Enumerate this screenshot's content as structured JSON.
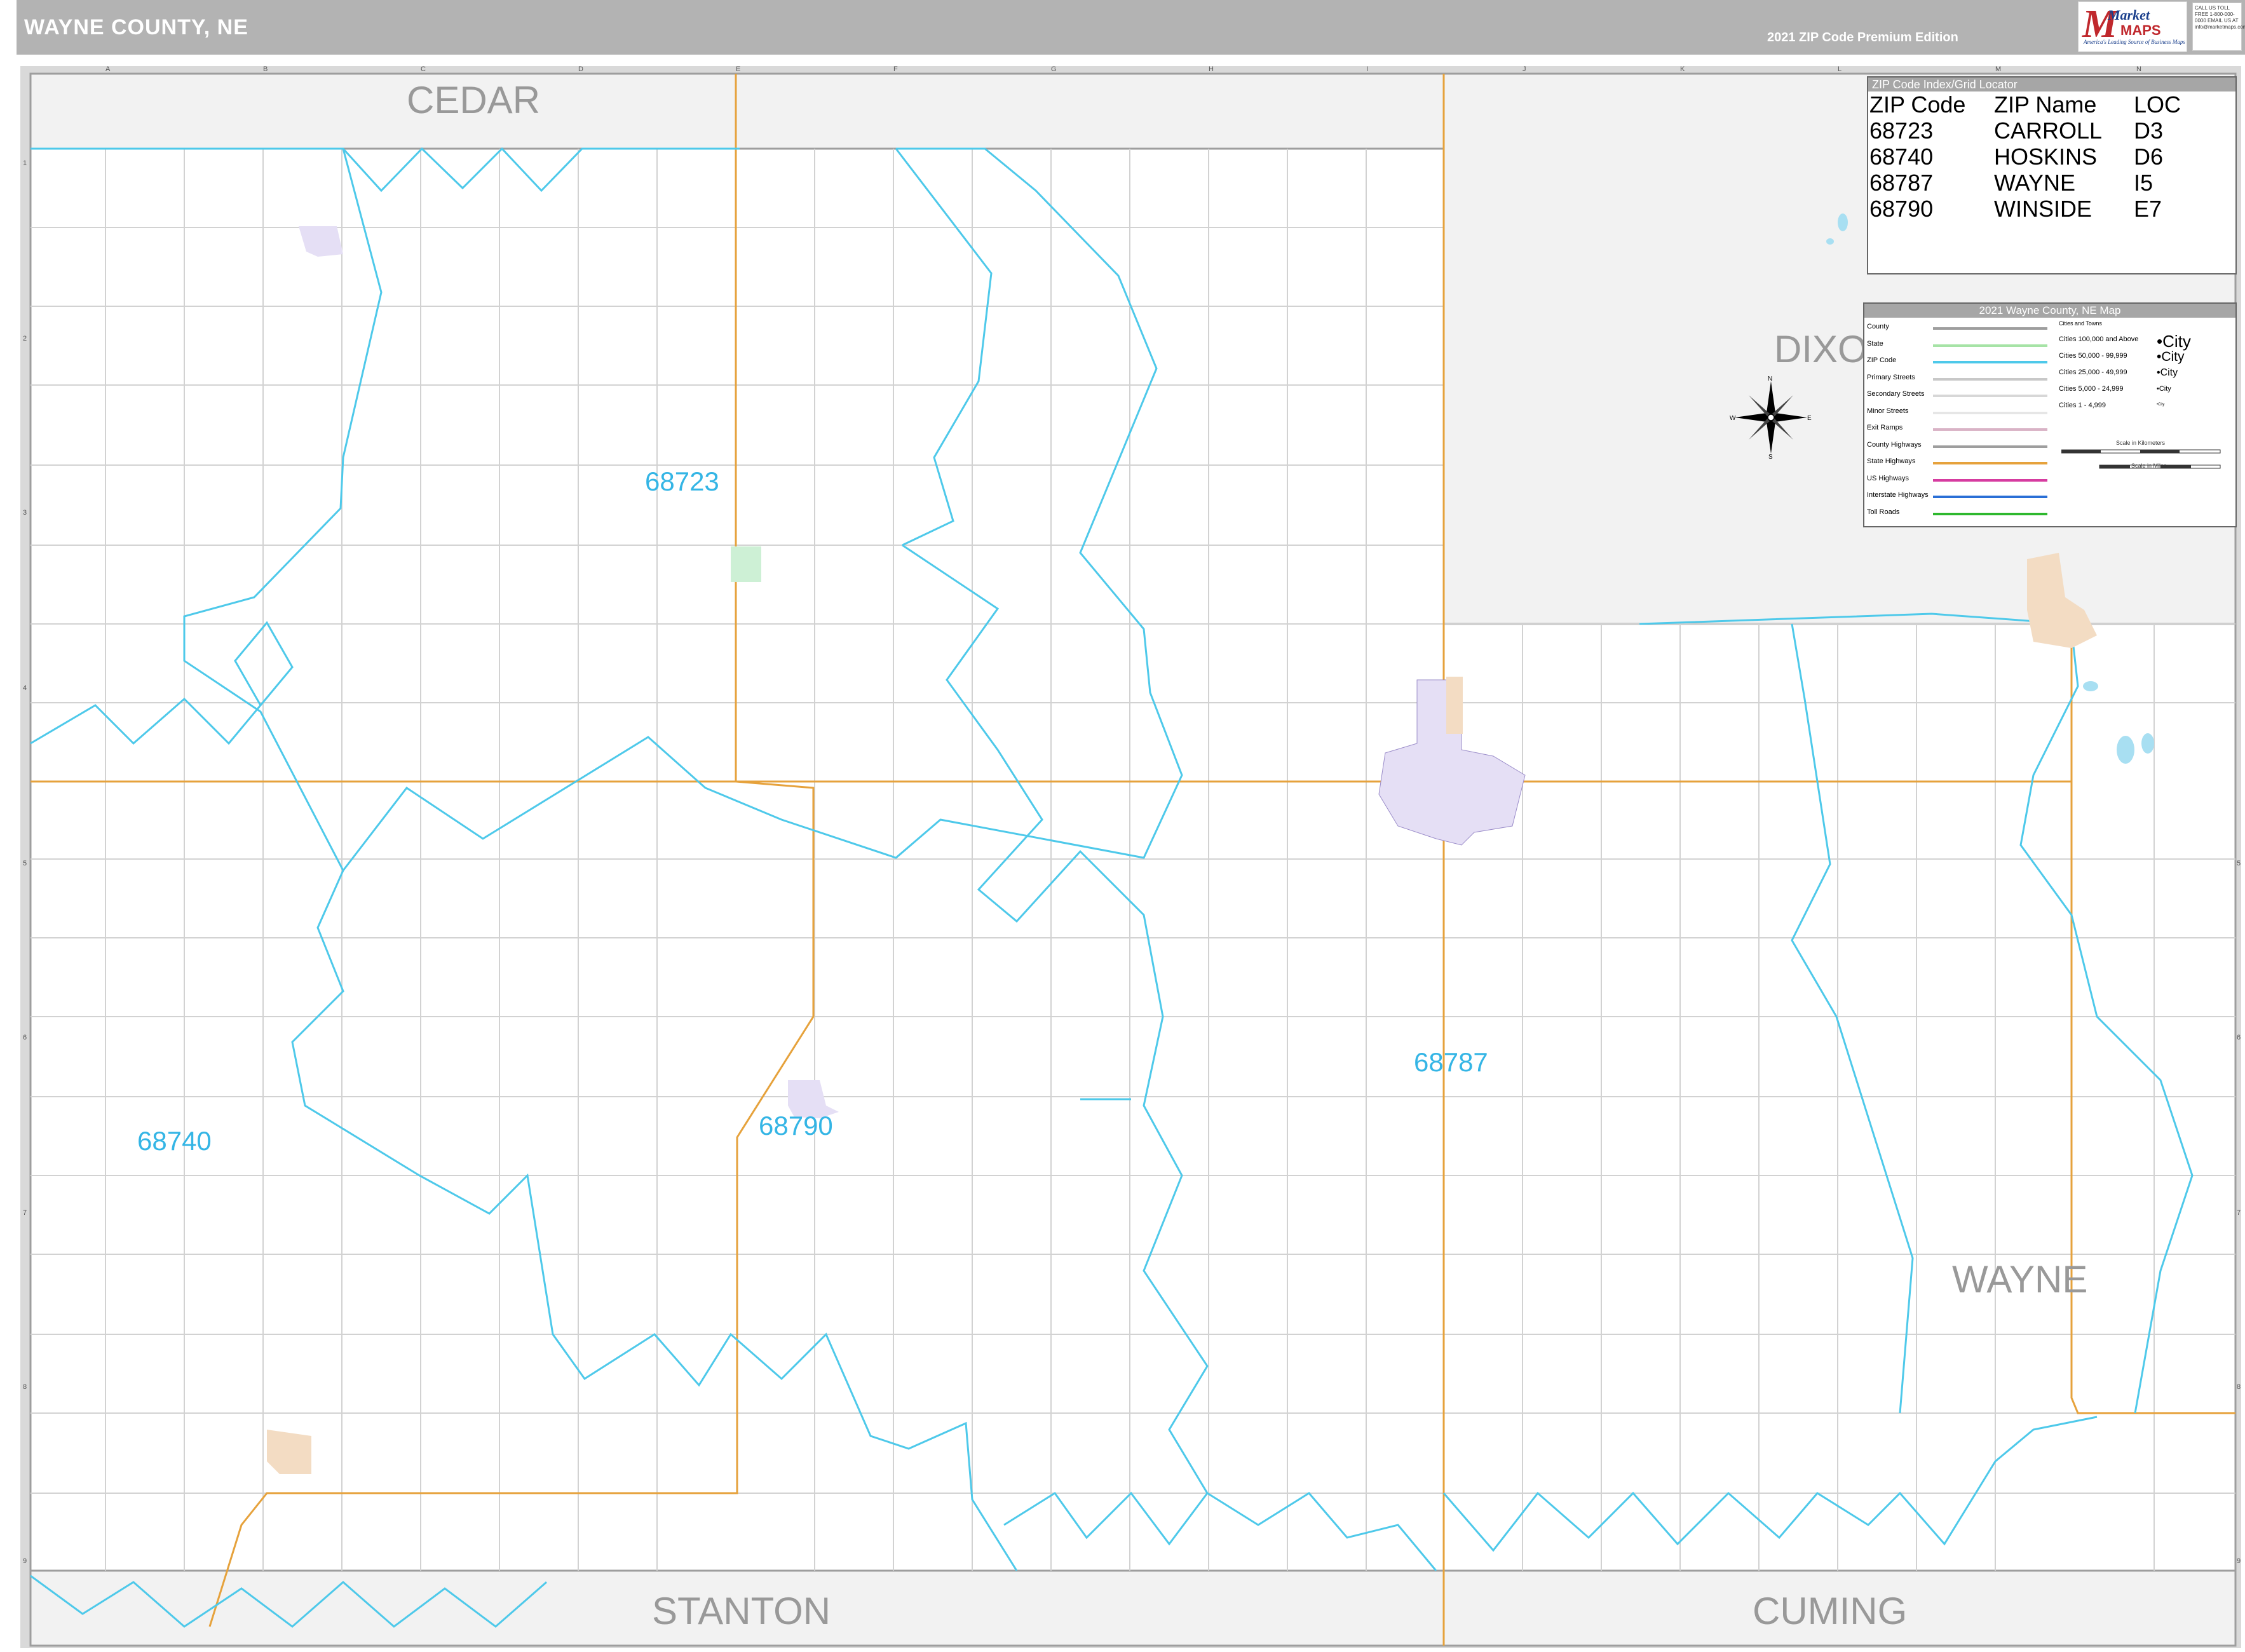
{
  "header": {
    "title": "WAYNE COUNTY, NE",
    "edition": "2021 ZIP Code Premium Edition",
    "logo_market": "Market",
    "logo_maps": "MAPS",
    "logo_tagline": "America's Leading Source of Business Maps",
    "contact": "CALL US TOLL FREE 1-800-000-0000 EMAIL US AT info@marketmaps.com"
  },
  "grid": {
    "columns": [
      "A",
      "B",
      "C",
      "D",
      "E",
      "F",
      "G",
      "H",
      "I",
      "J",
      "K",
      "L",
      "M",
      "N"
    ],
    "rows": [
      "1",
      "2",
      "3",
      "4",
      "5",
      "6",
      "7",
      "8",
      "9"
    ]
  },
  "counties": {
    "current": "WAYNE",
    "neighbors": {
      "north": "CEDAR",
      "northeast": "DIXON",
      "south": "STANTON",
      "southeast": "CUMING"
    }
  },
  "zip_labels": [
    "68723",
    "68787",
    "68740",
    "68790"
  ],
  "zip_index": {
    "title": "ZIP Code Index/Grid Locator",
    "headers": [
      "ZIP Code",
      "ZIP Name",
      "LOC"
    ],
    "rows": [
      [
        "68723",
        "CARROLL",
        "D3"
      ],
      [
        "68740",
        "HOSKINS",
        "D6"
      ],
      [
        "68787",
        "WAYNE",
        "I5"
      ],
      [
        "68790",
        "WINSIDE",
        "E7"
      ]
    ]
  },
  "legend": {
    "title": "2021 Wayne County, NE Map",
    "items": [
      {
        "label": "County",
        "color": "#9e9e9e"
      },
      {
        "label": "State",
        "color": "#a6e3a6"
      },
      {
        "label": "ZIP Code",
        "color": "#4ec9ea"
      },
      {
        "label": "Primary Streets",
        "color": "#c8c8c8"
      },
      {
        "label": "Secondary Streets",
        "color": "#d7d7d7"
      },
      {
        "label": "Minor Streets",
        "color": "#e6e6e6"
      },
      {
        "label": "Exit Ramps",
        "color": "#d9b3c6"
      },
      {
        "label": "County Highways",
        "color": "#9e9e9e"
      },
      {
        "label": "State Highways",
        "color": "#e6a23c"
      },
      {
        "label": "US Highways",
        "color": "#d63ca0"
      },
      {
        "label": "Interstate Highways",
        "color": "#2a6fd6"
      },
      {
        "label": "Toll Roads",
        "color": "#2eb82e"
      }
    ],
    "cities_heading": "Cities and Towns",
    "cities": [
      {
        "label": "Cities 100,000 and Above",
        "sample": "City"
      },
      {
        "label": "Cities 50,000 - 99,999",
        "sample": "City"
      },
      {
        "label": "Cities 25,000 - 49,999",
        "sample": "City"
      },
      {
        "label": "Cities 5,000 - 24,999",
        "sample": "City"
      },
      {
        "label": "Cities 1 - 4,999",
        "sample": "City"
      }
    ],
    "scale_km": "Scale in Kilometers",
    "scale_mi": "Scale in Miles"
  },
  "compass": {
    "n": "N",
    "s": "S",
    "e": "E",
    "w": "W"
  },
  "colors": {
    "zip_boundary": "#4ec9ea",
    "state_highway": "#e6a23c",
    "county_outline": "#9e9e9e",
    "outside_county": "#f2f2f2",
    "town_purple": "#e5dff5",
    "town_tan": "#f3dcc3",
    "town_green": "#cdf0d5"
  }
}
